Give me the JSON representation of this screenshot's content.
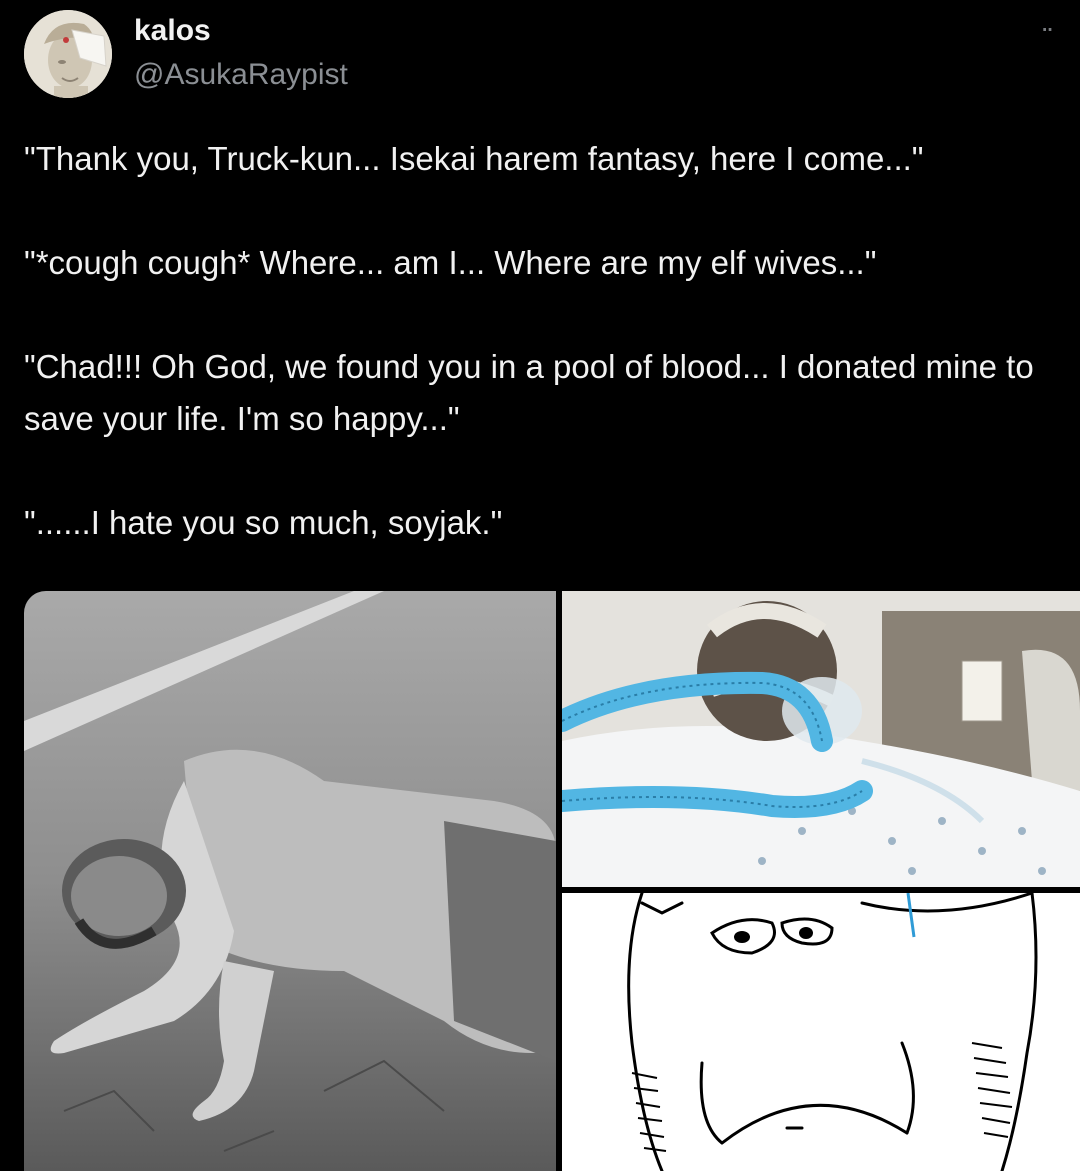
{
  "tweet": {
    "display_name": "kalos",
    "handle": "@AsukaRaypist",
    "more_icon": "more-dots-icon",
    "paragraphs": [
      "\"Thank you, Truck-kun... Isekai harem fantasy, here I come...\"",
      "\"*cough cough* Where... am I... Where are my elf wives...\"",
      "\"Chad!!! Oh God, we found you in a pool of blood... I donated mine to save your life. I'm so happy...\"",
      "\"......I hate you so much, soyjak.\""
    ]
  },
  "media": {
    "count": 3,
    "accent_colors": {
      "tube_blue": "#52b6e3",
      "background": "#000000",
      "text": "#f1f1f1",
      "handle": "#8b8f94"
    }
  }
}
